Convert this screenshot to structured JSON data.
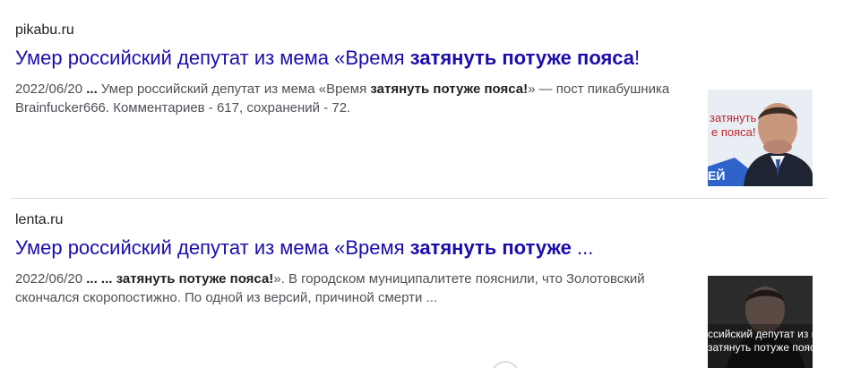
{
  "results": [
    {
      "site": "pikabu.ru",
      "title_pre": "Умер российский депутат из мема «Время ",
      "title_bold": "затянуть потуже пояса",
      "title_post": "!",
      "date": "2022/06/20",
      "ellipsis": " ... ",
      "snippet_pre": "Умер российский депутат из мема «Время ",
      "snippet_bold": "затянуть потуже пояса!",
      "snippet_post": "» — пост пикабушника Brainfucker666. Комментариев - 617, сохранений - 72.",
      "thumb": {
        "line1": "затянуть",
        "line2": "е пояса!",
        "edge_text": "ЕЙ"
      }
    },
    {
      "site": "lenta.ru",
      "title_pre": "Умер российский депутат из мема «Время ",
      "title_bold": "затянуть потуже",
      "title_post": " ...",
      "date": "2022/06/20",
      "ellipsis": " ... ... ",
      "snippet_pre": "",
      "snippet_bold": "затянуть потуже пояса!",
      "snippet_post": "». В городском муниципалитете пояснили, что Золотовский скончался скоропостижно. По одной из версий, причиной смерти ...",
      "thumb": {
        "line1": "ссийский депутат из м",
        "line2": "затянуть потуже пояса"
      }
    }
  ],
  "colors": {
    "link": "#1a0dab",
    "snippet": "#4d5156",
    "divider": "#dadce0",
    "thumb1_accent": "#c0262d",
    "thumb1_bg": "#2f63c9"
  }
}
